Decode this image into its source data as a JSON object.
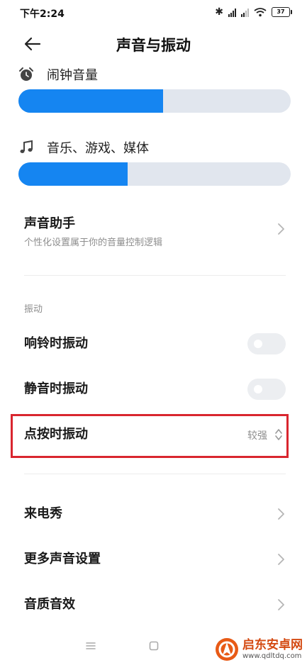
{
  "status_bar": {
    "time": "下午2:24",
    "battery": "37"
  },
  "header": {
    "title": "声音与振动"
  },
  "volume": {
    "alarm": {
      "label": "闹钟音量",
      "level": 0.53,
      "icon": "alarm-clock-icon"
    },
    "media": {
      "label": "音乐、游戏、媒体",
      "level": 0.4,
      "icon": "music-note-icon"
    }
  },
  "sound_assistant": {
    "title": "声音助手",
    "subtitle": "个性化设置属于你的音量控制逻辑"
  },
  "vibration": {
    "section_label": "振动",
    "ring": {
      "label": "响铃时振动",
      "enabled": false
    },
    "silent": {
      "label": "静音时振动",
      "enabled": false
    },
    "tap": {
      "label": "点按时振动",
      "value": "较强"
    }
  },
  "more": {
    "caller_show": "来电秀",
    "more_sound_settings": "更多声音设置",
    "sound_quality": "音质音效"
  },
  "watermark": {
    "title": "启东安卓网",
    "url": "www.qdltdq.com"
  },
  "colors": {
    "accent": "#1585f1",
    "track": "#e1e6ee",
    "highlight": "#d9262f"
  }
}
